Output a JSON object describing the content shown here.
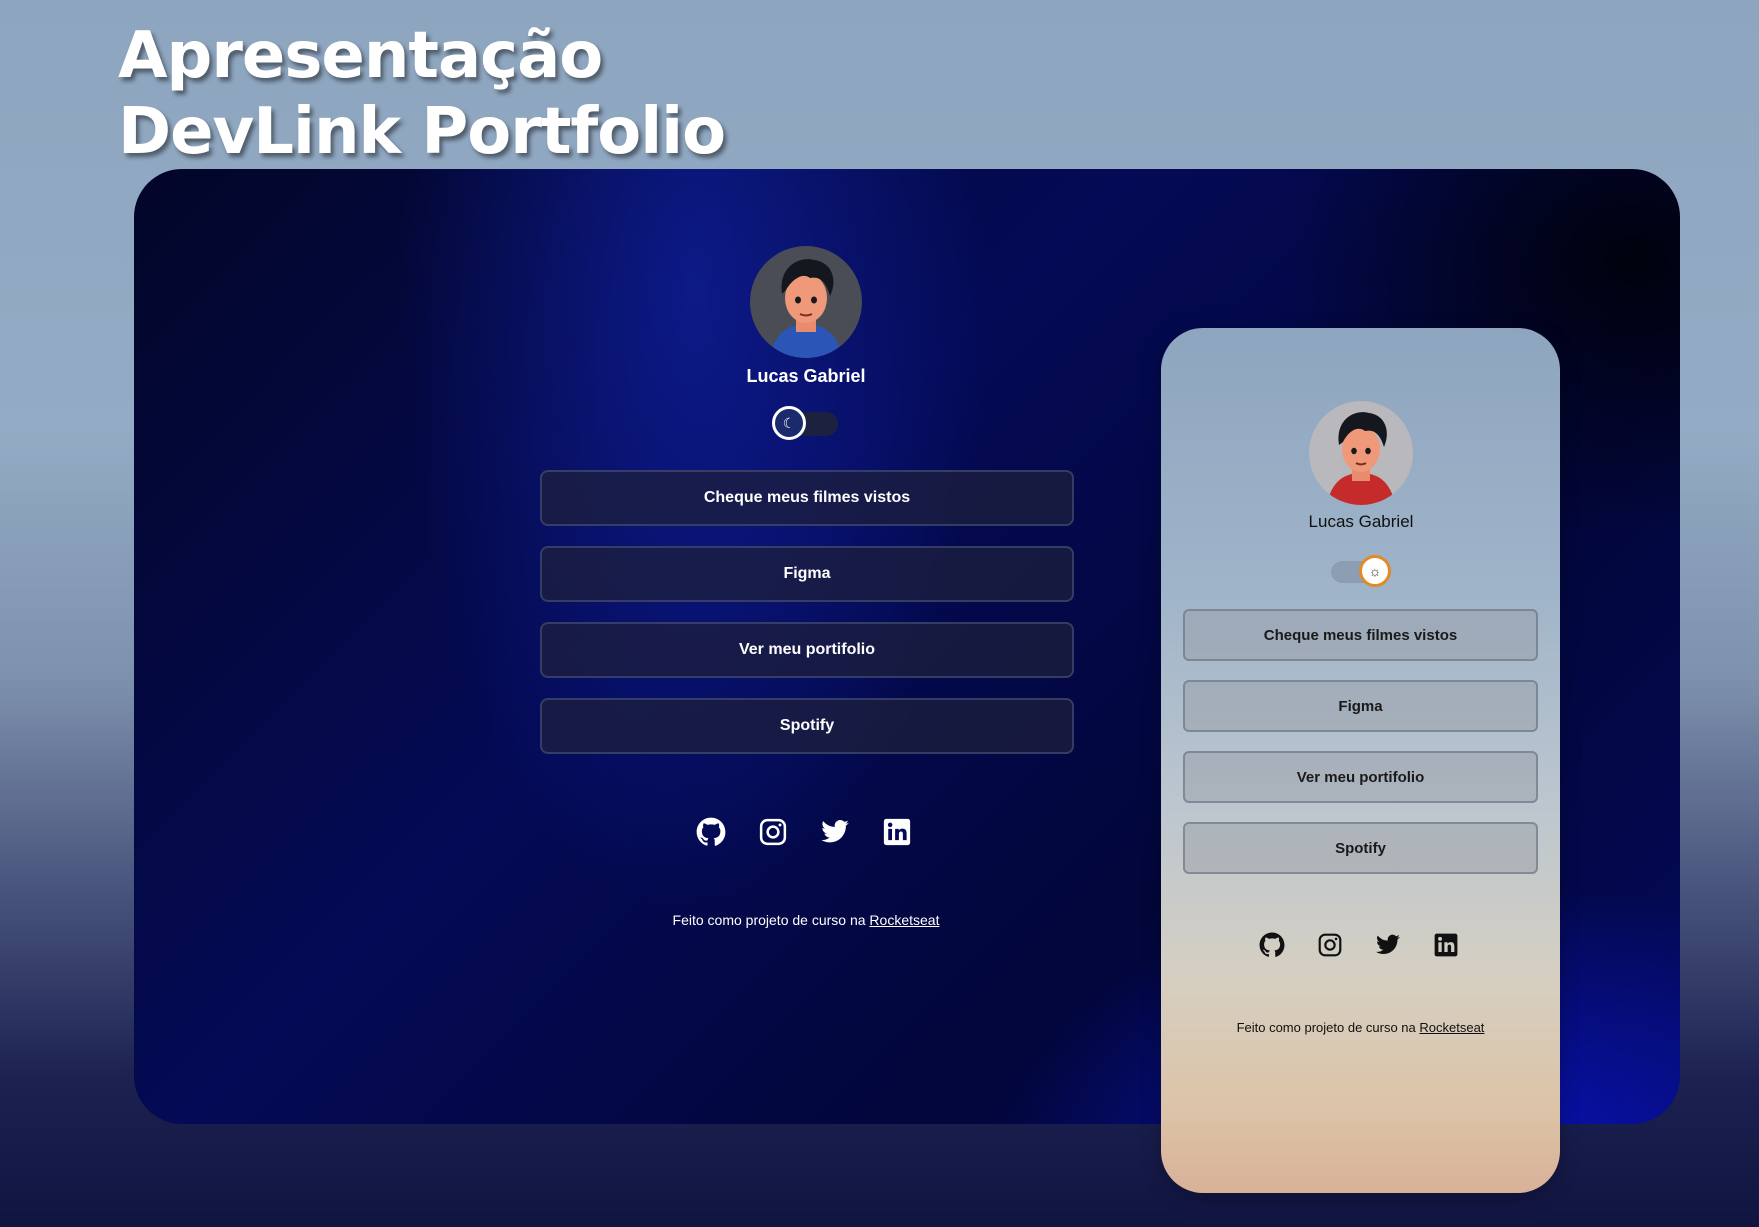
{
  "heading": {
    "line1": "Apresentação",
    "line2": "DevLink Portfolio"
  },
  "desktop": {
    "name": "Lucas Gabriel",
    "theme": "dark",
    "links": [
      "Cheque meus filmes vistos",
      "Figma",
      "Ver meu portifolio",
      "Spotify"
    ],
    "social": [
      "github-icon",
      "instagram-icon",
      "twitter-icon",
      "linkedin-icon"
    ],
    "footer_text": "Feito como projeto de curso na ",
    "footer_link": "Rocketseat"
  },
  "mobile": {
    "name": "Lucas Gabriel",
    "theme": "light",
    "links": [
      "Cheque meus filmes vistos",
      "Figma",
      "Ver meu portifolio",
      "Spotify"
    ],
    "social": [
      "github-icon",
      "instagram-icon",
      "twitter-icon",
      "linkedin-icon"
    ],
    "footer_text": "Feito como projeto de curso na ",
    "footer_link": "Rocketseat"
  },
  "colors": {
    "dark_bg": "#040a55",
    "light_knob_border": "#e08a2a",
    "accent_blue": "#1a2a6c"
  }
}
